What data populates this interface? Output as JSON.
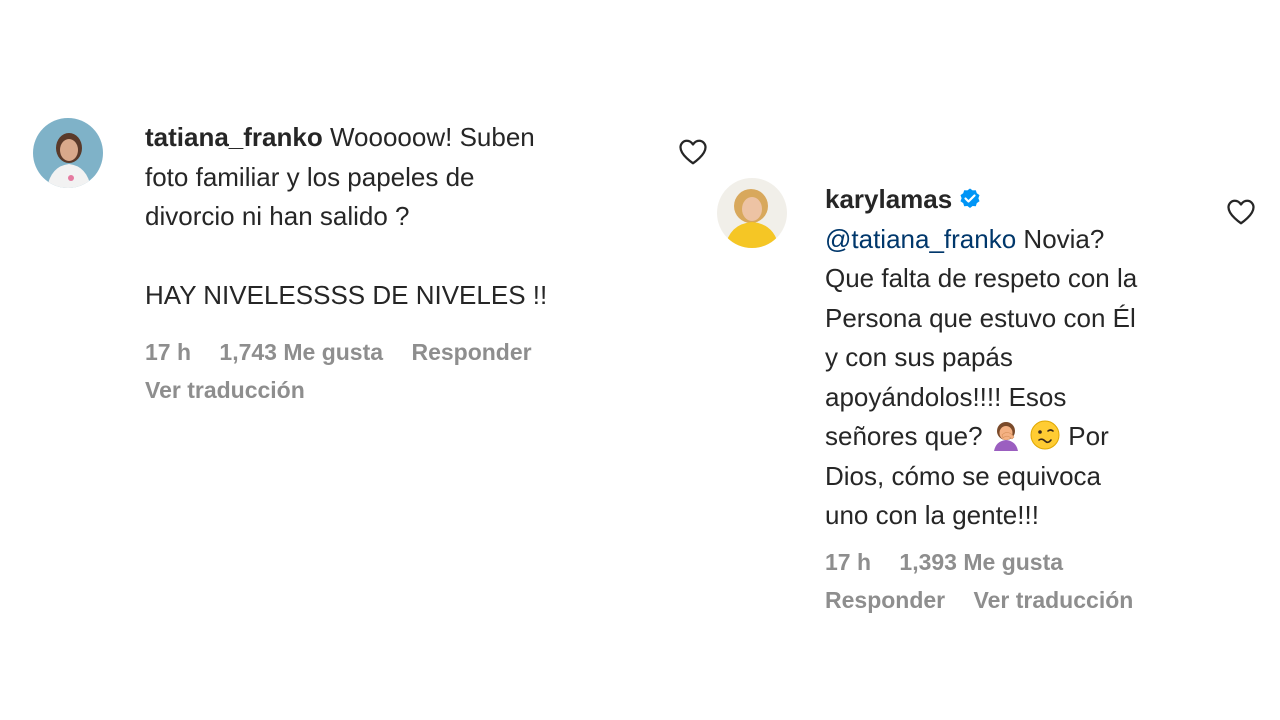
{
  "comments": [
    {
      "username": "tatiana_franko",
      "text_first": "Wooooow! Suben",
      "lines": [
        "foto familiar y los papeles de",
        "divorcio ni han salido ?",
        "",
        "HAY NIVELESSSS DE NIVELES !!"
      ],
      "time": "17 h",
      "likes": "1,743 Me gusta",
      "reply_label": "Responder",
      "translate_label": "Ver traducción"
    },
    {
      "username": "karylamas",
      "verified": true,
      "mention": "@tatiana_franko",
      "text_first": "Novia?",
      "lines": [
        "Que falta de respeto con la",
        "Persona que estuvo con Él",
        "y con sus papás",
        "apoyándolos!!!! Esos",
        "señores que?",
        "Por",
        "Dios, cómo se equivoca",
        "uno con la gente!!!"
      ],
      "emojis": [
        "woman-facepalming-emoji",
        "woozy-face-emoji"
      ],
      "time": "17 h",
      "likes": "1,393 Me gusta",
      "reply_label": "Responder",
      "translate_label": "Ver traducción"
    }
  ],
  "icons": {
    "like": "heart-outline-icon",
    "verified": "verified-badge-icon"
  },
  "colors": {
    "text": "#262626",
    "secondary": "#8e8e8e",
    "mention": "#00376b",
    "verified": "#0095f6"
  }
}
